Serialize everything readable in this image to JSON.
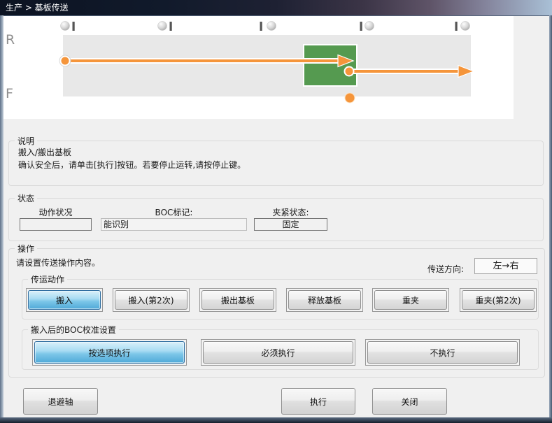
{
  "titlebar": {
    "title": "生产 > 基板传送"
  },
  "diagram": {
    "rear_label": "R",
    "front_label": "F",
    "colors": {
      "band": "#e8e8e8",
      "board_green": "#559a50",
      "arrow_orange": "#f5953b"
    }
  },
  "description": {
    "legend": "说明",
    "line1": "搬入/搬出基板",
    "line2": "确认安全后，请单击[执行]按钮。若要停止运转,请按停止键。"
  },
  "status": {
    "legend": "状态",
    "fields": [
      {
        "label": "动作状况",
        "value": ""
      },
      {
        "label": "BOC标记:",
        "value": "能识别"
      },
      {
        "label": "夹紧状态:",
        "value": "固定"
      }
    ]
  },
  "operation": {
    "legend": "操作",
    "instruction": "请设置传送操作内容。",
    "direction_label": "传送方向:",
    "direction_value": "左→右",
    "transfer_group": {
      "legend": "传运动作",
      "buttons": [
        {
          "label": "搬入",
          "selected": true
        },
        {
          "label": "搬入(第2次)",
          "selected": false
        },
        {
          "label": "搬出基板",
          "selected": false
        },
        {
          "label": "释放基板",
          "selected": false
        },
        {
          "label": "重夹",
          "selected": false
        },
        {
          "label": "重夹(第2次)",
          "selected": false
        }
      ]
    },
    "boc_group": {
      "legend": "搬入后的BOC校准设置",
      "buttons": [
        {
          "label": "按选项执行",
          "selected": true
        },
        {
          "label": "必须执行",
          "selected": false
        },
        {
          "label": "不执行",
          "selected": false
        }
      ]
    }
  },
  "footer": {
    "retract_label": "退避轴",
    "execute_label": "执行",
    "close_label": "关闭"
  }
}
